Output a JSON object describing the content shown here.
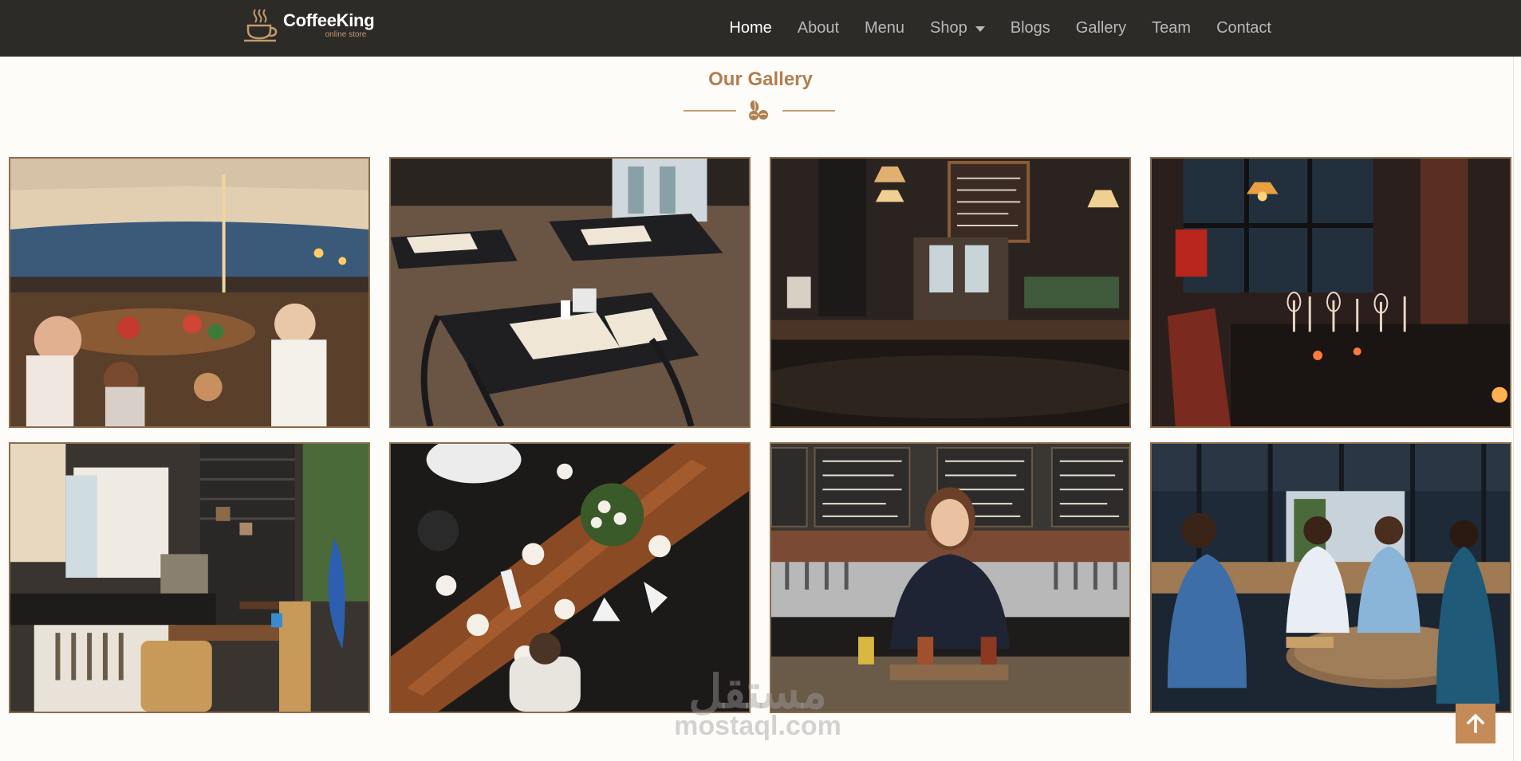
{
  "brand": {
    "name": "CoffeeKing",
    "tagline": "online store",
    "icon": "coffee-cup-icon"
  },
  "nav": {
    "items": [
      {
        "label": "Home",
        "active": true
      },
      {
        "label": "About"
      },
      {
        "label": "Menu"
      },
      {
        "label": "Shop",
        "dropdown": true
      },
      {
        "label": "Blogs"
      },
      {
        "label": "Gallery"
      },
      {
        "label": "Team"
      },
      {
        "label": "Contact"
      }
    ]
  },
  "section": {
    "title": "Our Gallery",
    "divider_icon": "coffee-beans-icon"
  },
  "gallery": {
    "photos": [
      {
        "subject": "outdoor-dinner-party-toast"
      },
      {
        "subject": "restaurant-tables-menus"
      },
      {
        "subject": "bar-interior-chalkboard"
      },
      {
        "subject": "dining-room-wine-glasses"
      },
      {
        "subject": "cafe-counter-shelves"
      },
      {
        "subject": "overhead-wooden-table"
      },
      {
        "subject": "bartender-serving-drinks"
      },
      {
        "subject": "friends-at-terrace-bar"
      }
    ]
  },
  "watermark": {
    "arabic": "مستقل",
    "latin": "mostaql.com"
  },
  "back_to_top": {
    "icon": "arrow-up-icon"
  },
  "colors": {
    "navbar": "#2c2b28",
    "accent": "#b07f4f",
    "button": "#c48a57",
    "frame": "#8a6d4e"
  }
}
